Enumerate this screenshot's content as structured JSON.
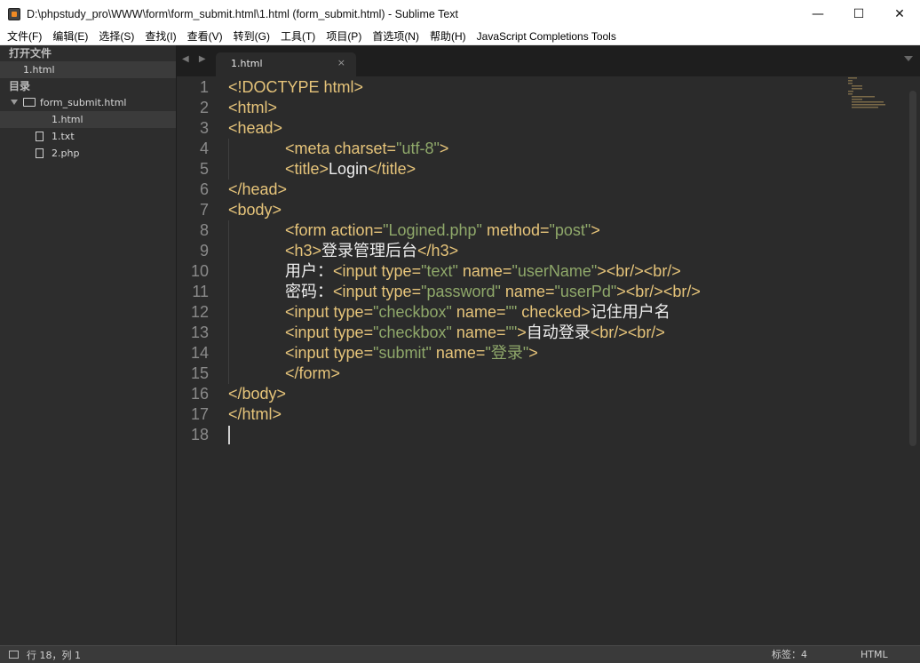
{
  "window": {
    "title": "D:\\phpstudy_pro\\WWW\\form\\form_submit.html\\1.html (form_submit.html) - Sublime Text",
    "minimize": "—",
    "maximize": "☐",
    "close": "✕"
  },
  "menu": [
    "文件(F)",
    "编辑(E)",
    "选择(S)",
    "查找(I)",
    "查看(V)",
    "转到(G)",
    "工具(T)",
    "项目(P)",
    "首选项(N)",
    "帮助(H)",
    "JavaScript Completions Tools"
  ],
  "sidebar": {
    "open_files_heading": "打开文件",
    "open_files": [
      "1.html"
    ],
    "folders_heading": "目录",
    "folder": "form_submit.html",
    "files": [
      "1.html",
      "1.txt",
      "2.php"
    ]
  },
  "tabs": {
    "nav": "◀ ▶",
    "active": "1.html",
    "close": "×"
  },
  "editor": {
    "line_numbers": [
      "1",
      "2",
      "3",
      "4",
      "5",
      "6",
      "7",
      "8",
      "9",
      "10",
      "11",
      "12",
      "13",
      "14",
      "15",
      "16",
      "17",
      "18"
    ]
  },
  "status": {
    "position": "行 18，列 1",
    "tab_size": "标签：4",
    "syntax": "HTML"
  },
  "colors": {
    "tag": "#e6c47a",
    "string": "#8fa86a",
    "text": "#ededed",
    "background": "#2b2b2b"
  }
}
